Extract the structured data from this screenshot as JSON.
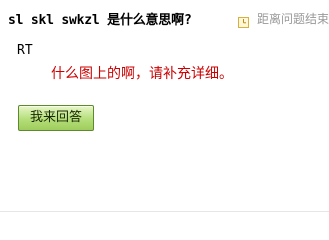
{
  "question": {
    "title": "sl skl swkzl 是什么意思啊?",
    "deadline_text": "距离问题结束",
    "body": "RT"
  },
  "comment": {
    "text": "什么图上的啊，请补充详细。"
  },
  "actions": {
    "answer_label": "我来回答"
  },
  "colors": {
    "comment_red": "#cc0000",
    "muted_gray": "#999999",
    "button_green": "#b4de7a"
  },
  "icons": {
    "deadline": "clock-icon"
  }
}
